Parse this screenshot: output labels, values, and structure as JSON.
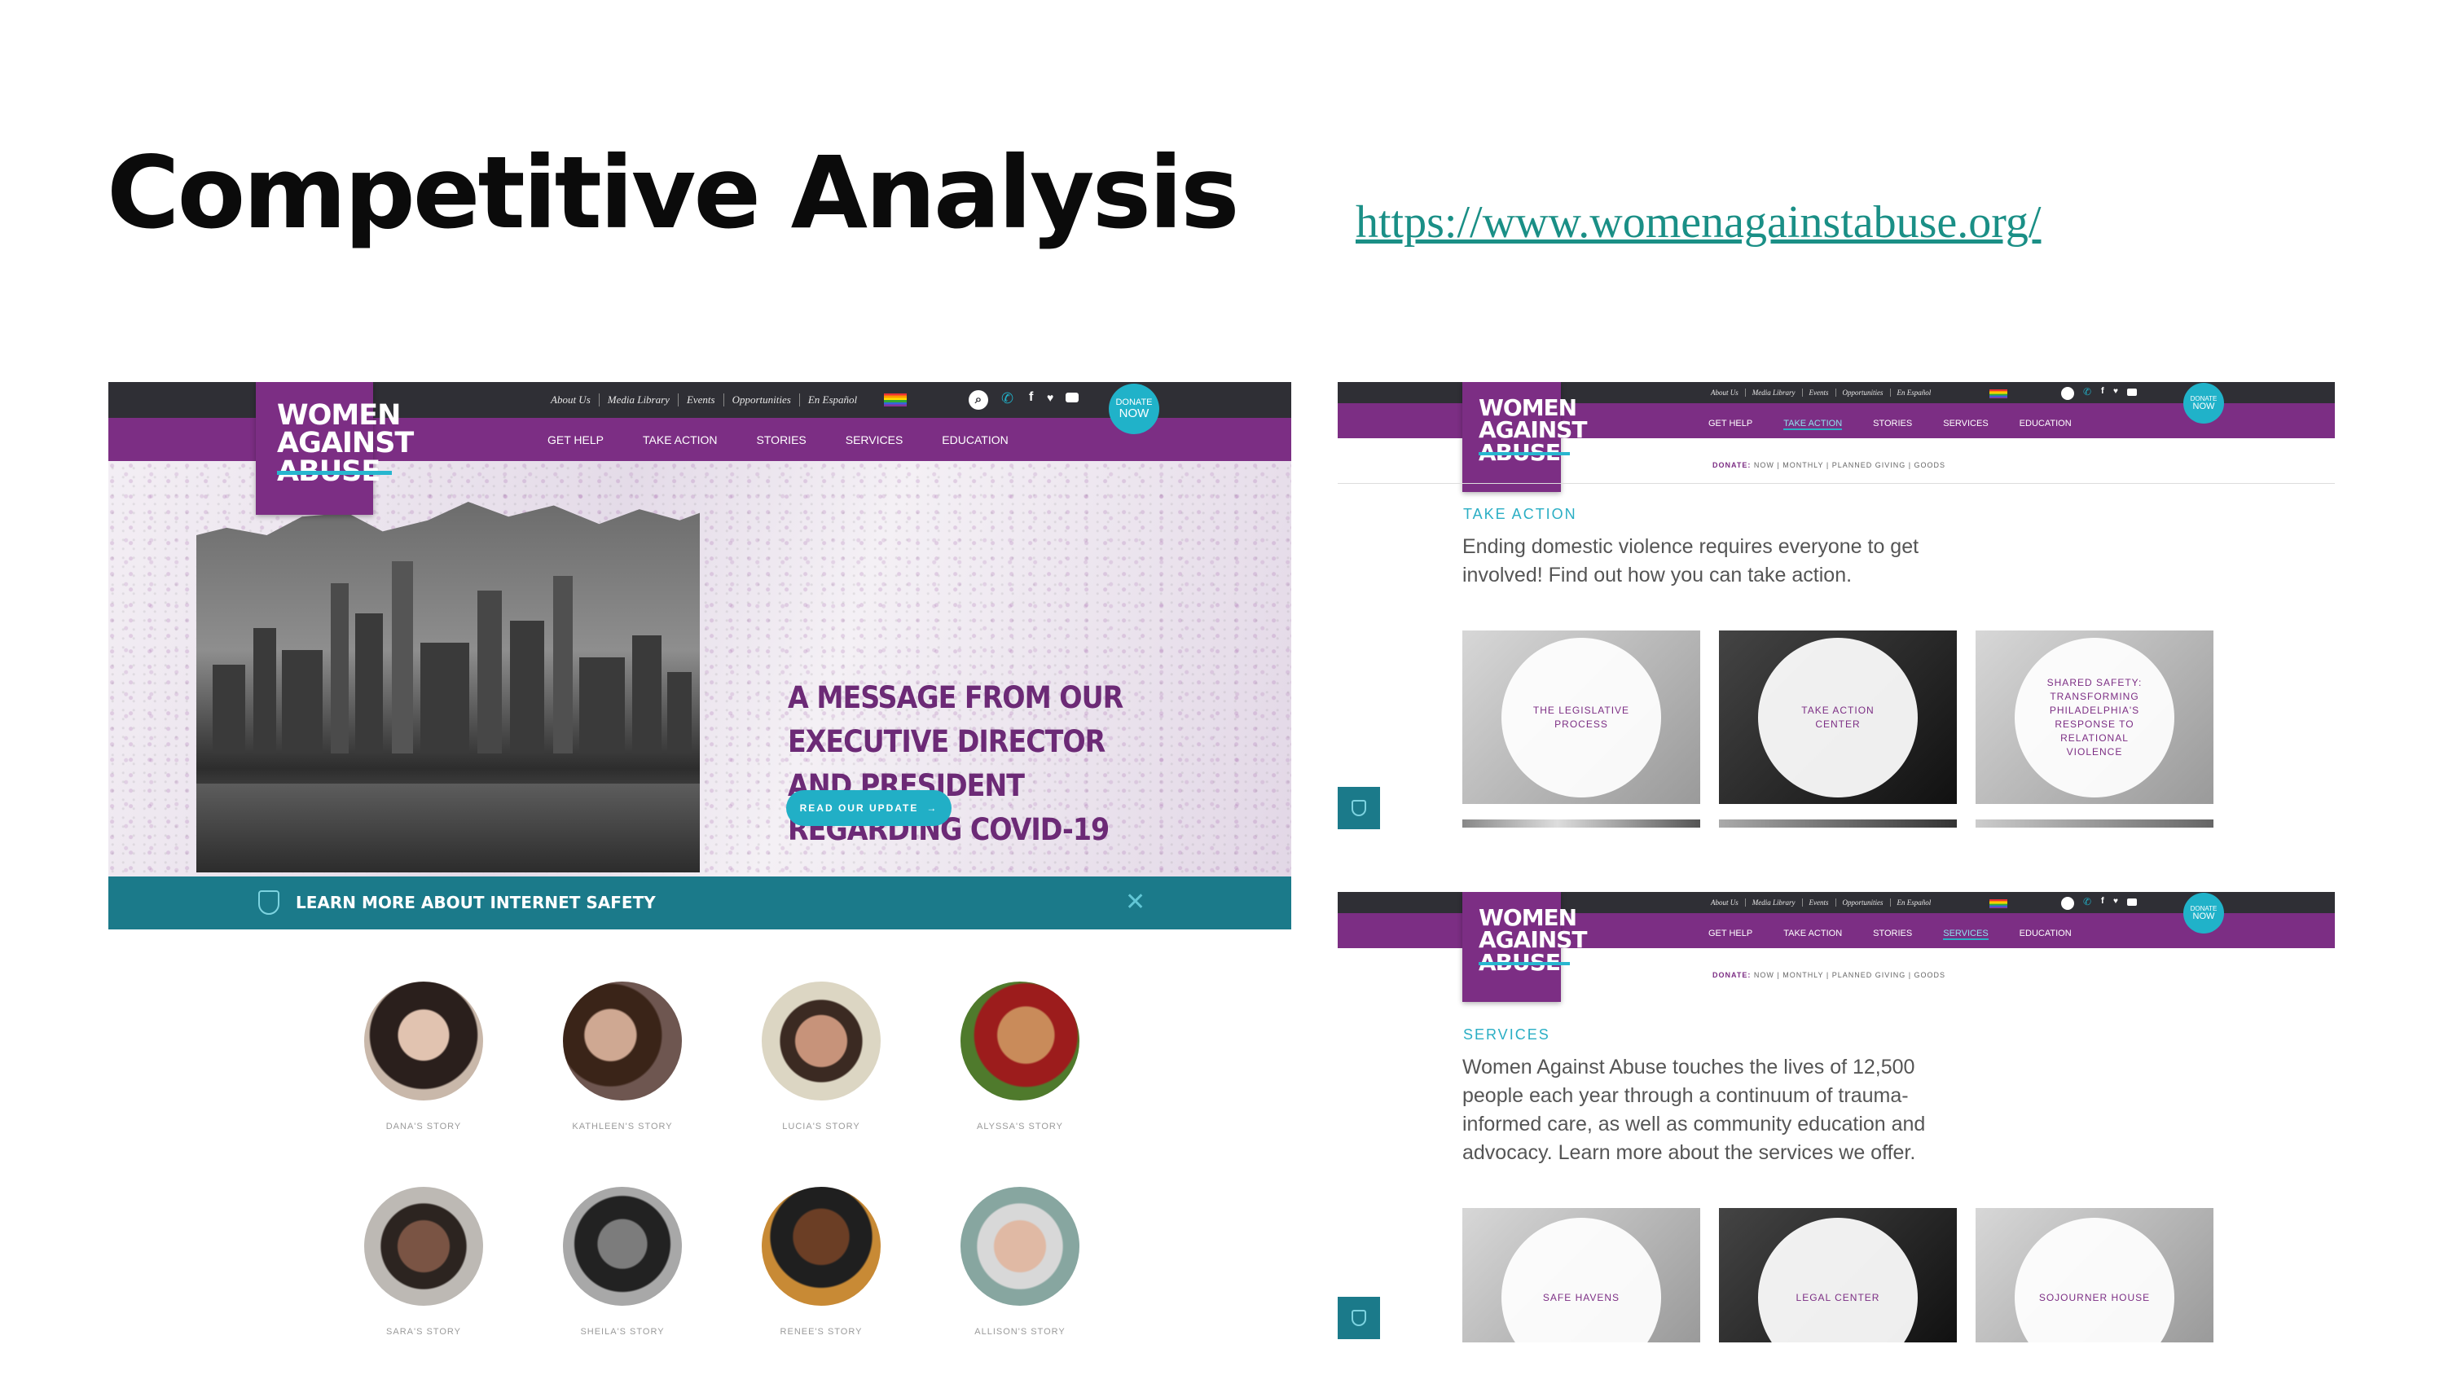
{
  "slide": {
    "title": "Competitive Analysis",
    "link": "https://www.womenagainstabuse.org/"
  },
  "site": {
    "logo_lines": [
      "WOMEN",
      "AGAINST",
      "ABUSE"
    ],
    "utility_links": [
      "About Us",
      "Media Library",
      "Events",
      "Opportunities",
      "En Español"
    ],
    "nav": [
      "GET HELP",
      "TAKE ACTION",
      "STORIES",
      "SERVICES",
      "EDUCATION"
    ],
    "donate": [
      "DONATE",
      "NOW"
    ],
    "brand_purple": "#7c2e84",
    "brand_teal": "#21afc6"
  },
  "home": {
    "hero_heading": "A MESSAGE FROM OUR EXECUTIVE DIRECTOR AND PRESIDENT REGARDING COVID-19",
    "hero_button": "READ OUR UPDATE",
    "safety_bar": "LEARN MORE ABOUT INTERNET SAFETY",
    "stories": [
      "DANA'S STORY",
      "KATHLEEN'S STORY",
      "LUCIA'S STORY",
      "ALYSSA'S STORY",
      "SARA'S STORY",
      "SHEILA'S STORY",
      "RENEE'S STORY",
      "ALLISON'S STORY"
    ]
  },
  "donate_bar": {
    "label": "DONATE:",
    "options": "NOW | MONTHLY | PLANNED GIVING | GOODS"
  },
  "take_action_page": {
    "section": "TAKE ACTION",
    "intro": "Ending domestic violence requires everyone to get involved! Find out how you can take action.",
    "tiles": [
      "THE LEGISLATIVE PROCESS",
      "TAKE ACTION CENTER",
      "SHARED SAFETY: TRANSFORMING PHILADELPHIA'S RESPONSE TO RELATIONAL VIOLENCE"
    ]
  },
  "services_page": {
    "section": "SERVICES",
    "intro": "Women Against Abuse touches the lives of 12,500 people each year through a continuum of trauma-informed care, as well as community education and advocacy. Learn more about the services we offer.",
    "tiles": [
      "SAFE HAVENS",
      "LEGAL CENTER",
      "SOJOURNER HOUSE"
    ]
  }
}
